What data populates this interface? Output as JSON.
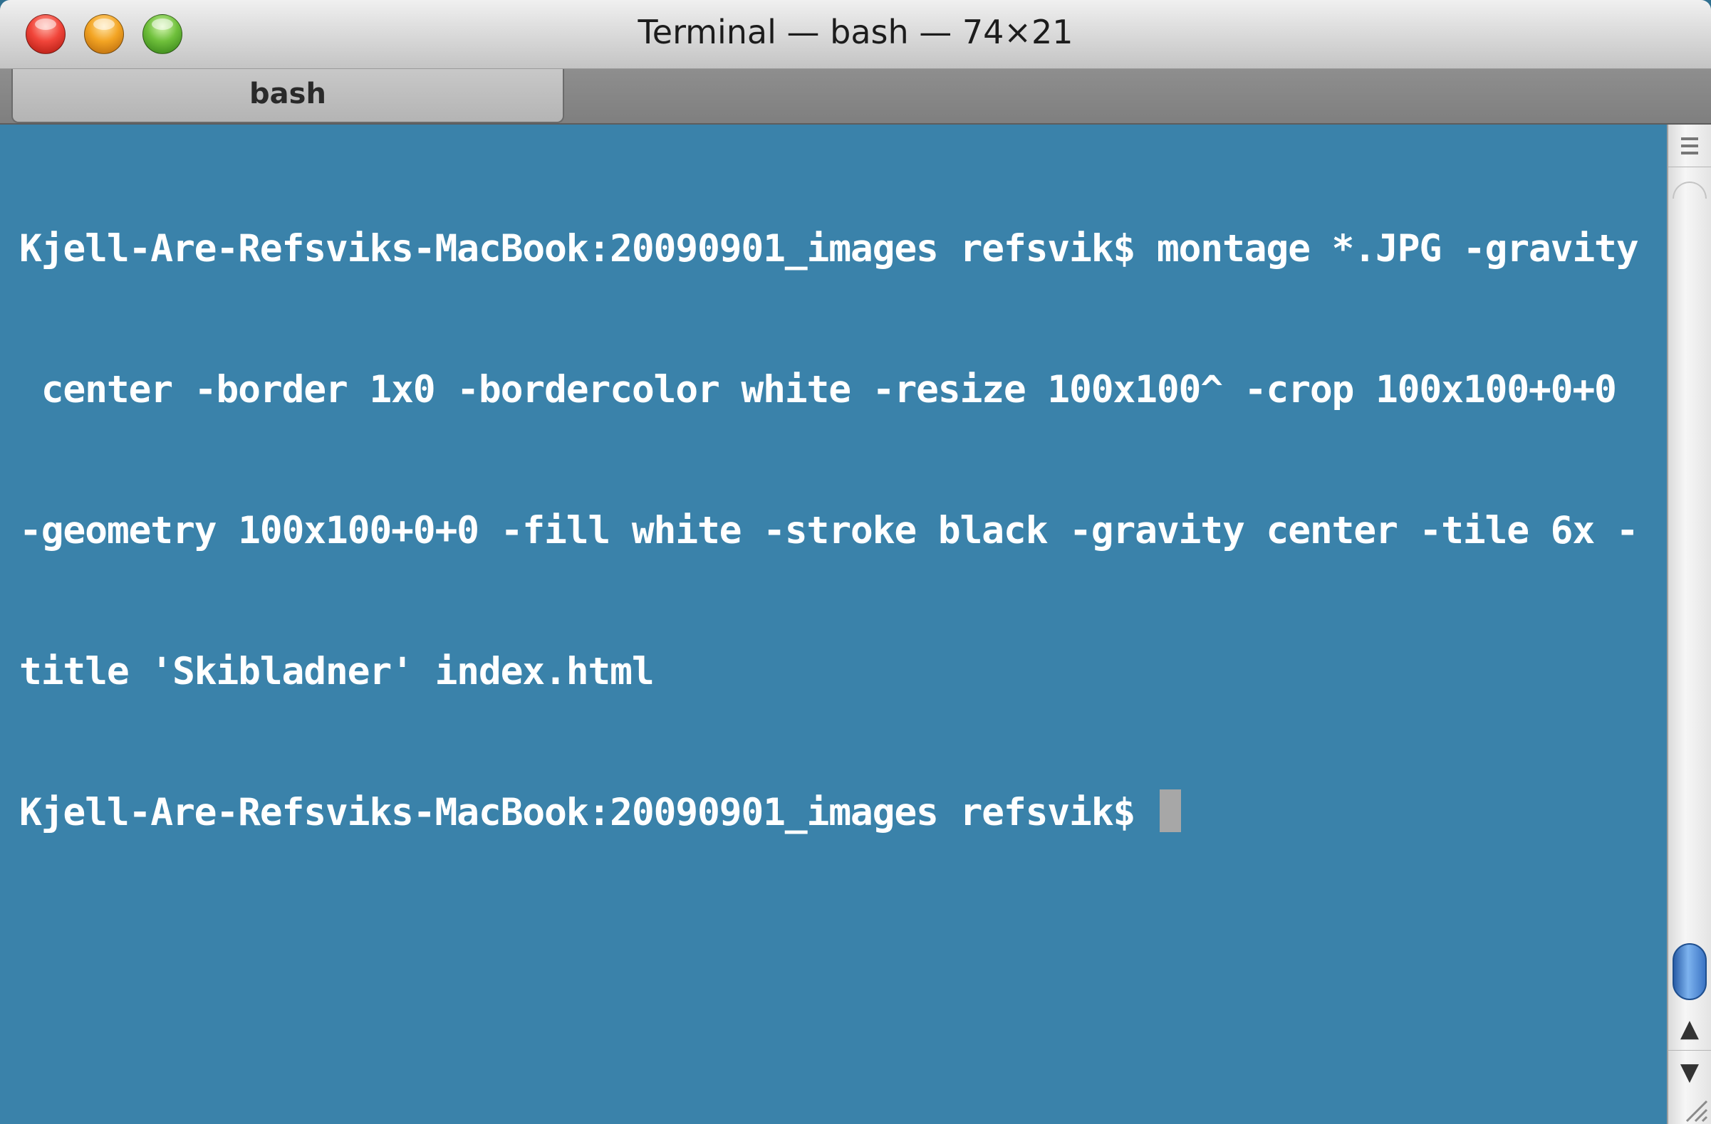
{
  "window": {
    "title": "Terminal — bash — 74×21"
  },
  "tabs": [
    {
      "label": "bash"
    }
  ],
  "terminal": {
    "lines": [
      "Kjell-Are-Refsviks-MacBook:20090901_images refsvik$ montage *.JPG -gravity",
      " center -border 1x0 -bordercolor white -resize 100x100^ -crop 100x100+0+0",
      "-geometry 100x100+0+0 -fill white -stroke black -gravity center -tile 6x -",
      "title 'Skibladner' index.html",
      "Kjell-Are-Refsviks-MacBook:20090901_images refsvik$ "
    ]
  },
  "icons": {
    "close": "close-button-icon",
    "minimize": "minimize-button-icon",
    "zoom": "zoom-button-icon",
    "split": "split-pane-icon",
    "scroll_up": "arrow-up-icon",
    "scroll_down": "arrow-down-icon",
    "resize": "resize-grip-icon",
    "scroll_up_glyph": "▲",
    "scroll_down_glyph": "▼"
  },
  "colors": {
    "terminal_background": "#3a82aa",
    "terminal_text": "#ffffff",
    "cursor": "#a7a7a7",
    "scroll_thumb": "#3b74c4"
  }
}
